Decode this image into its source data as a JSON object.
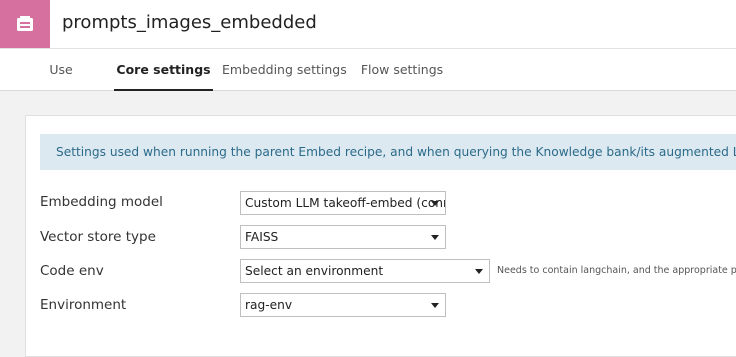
{
  "header": {
    "title": "prompts_images_embedded",
    "icon": "knowledge-bank-icon",
    "icon_color": "#d6709e"
  },
  "tabs": [
    {
      "label": "Use",
      "active": false
    },
    {
      "label": "Core settings",
      "active": true
    },
    {
      "label": "Embedding settings",
      "active": false
    },
    {
      "label": "Flow settings",
      "active": false
    }
  ],
  "info": {
    "text": "Settings used when running the parent Embed recipe, and when querying the Knowledge bank/its augmented LLMs"
  },
  "form": {
    "embedding_model": {
      "label": "Embedding model",
      "value": "Custom LLM takeoff-embed (conn"
    },
    "vector_store_type": {
      "label": "Vector store type",
      "value": "FAISS"
    },
    "code_env": {
      "label": "Code env",
      "value": "Select an environment",
      "help": "Needs to contain langchain, and the appropriate packag"
    },
    "environment": {
      "label": "Environment",
      "value": "rag-env"
    }
  }
}
